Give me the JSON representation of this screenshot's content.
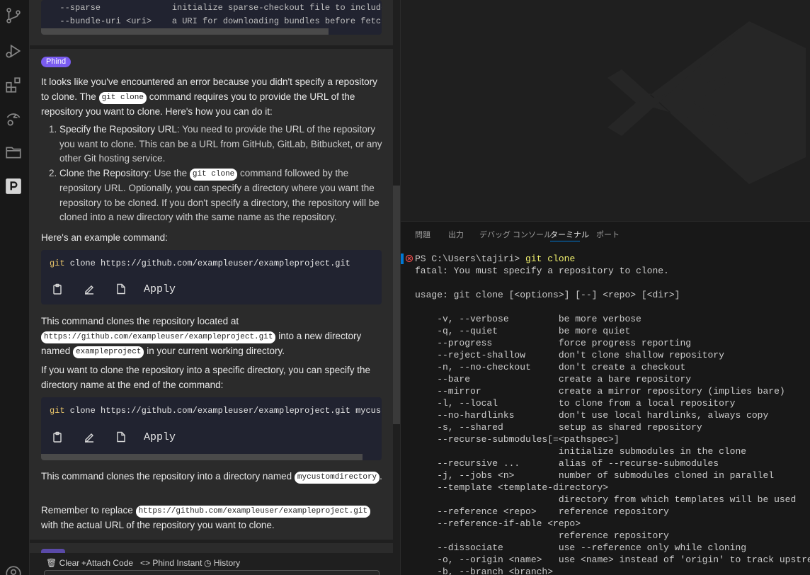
{
  "activity_bar": {
    "icons": [
      "source-control-icon",
      "run-debug-icon",
      "extensions-icon",
      "remote-explorer-icon",
      "folder-icon",
      "phind-icon",
      "account-icon"
    ]
  },
  "chat": {
    "top_help_lines": [
      "  --sparse              initialize sparse-checkout file to include only fil",
      "  --bundle-uri <uri>    a URI for downloading bundles before fetching from"
    ],
    "badge": "Phind",
    "intro": {
      "t1": "It looks like you've encountered an error because you didn't specify a repository to clone. The ",
      "c1": "git clone",
      "t2": " command requires you to provide the URL of the repository you want to clone. Here's how you can do it:"
    },
    "steps": [
      {
        "title": "Specify the Repository URL",
        "body": ": You need to provide the URL of the repository you want to clone. This can be a URL from GitHub, GitLab, Bitbucket, or any other Git hosting service."
      },
      {
        "title": "Clone the Repository",
        "body_pre": ": Use the ",
        "code": "git clone",
        "body_post": " command followed by the repository URL. Optionally, you can specify a directory where you want the repository to be cloned. If you don't specify a directory, the repository will be cloned into a new directory with the same name as the repository."
      }
    ],
    "example_label": "Here's an example command:",
    "code1": {
      "kw": "git",
      "rest": " clone https://github.com/exampleuser/exampleproject.git"
    },
    "code2": {
      "kw": "git",
      "rest": " clone https://github.com/exampleuser/exampleproject.git mycustomdirectory"
    },
    "apply_label": "Apply",
    "para2": {
      "t1": "This command clones the repository located at ",
      "c1": "https://github.com/exampleuser/exampleproject.git",
      "t2": " into a new directory named ",
      "c2": "exampleproject",
      "t3": " in your current working directory."
    },
    "para3": "If you want to clone the repository into a specific directory, you can specify the directory name at the end of the command:",
    "para4": {
      "t1": "This command clones the repository into a directory named ",
      "c1": "mycustomdirectory",
      "t2": "."
    },
    "para5": {
      "t1": "Remember to replace ",
      "c1": "https://github.com/exampleuser/exampleproject.git",
      "t2": " with the actual URL of the repository you want to clone."
    },
    "toolbar": {
      "clear": "Clear",
      "attach": "+Attach Code",
      "instant": "Phind Instant",
      "history": "History"
    }
  },
  "panel": {
    "tabs": [
      "問題",
      "出力",
      "デバッグ コンソール",
      "ターミナル",
      "ポート"
    ],
    "active_tab": "ターミナル",
    "prompt": "PS C:\\Users\\tajiri> ",
    "command": "git clone",
    "output": "fatal: You must specify a repository to clone.\n\nusage: git clone [<options>] [--] <repo> [<dir>]\n\n    -v, --verbose         be more verbose\n    -q, --quiet           be more quiet\n    --progress            force progress reporting\n    --reject-shallow      don't clone shallow repository\n    -n, --no-checkout     don't create a checkout\n    --bare                create a bare repository\n    --mirror              create a mirror repository (implies bare)\n    -l, --local           to clone from a local repository\n    --no-hardlinks        don't use local hardlinks, always copy\n    -s, --shared          setup as shared repository\n    --recurse-submodules[=<pathspec>]\n                          initialize submodules in the clone\n    --recursive ...       alias of --recurse-submodules\n    -j, --jobs <n>        number of submodules cloned in parallel\n    --template <template-directory>\n                          directory from which templates will be used\n    --reference <repo>    reference repository\n    --reference-if-able <repo>\n                          reference repository\n    --dissociate          use --reference only while cloning\n    -o, --origin <name>   use <name> instead of 'origin' to track upstream\n    -b, --branch <branch>"
  },
  "colors": {
    "accent": "#0078d4",
    "phind_badge": "#7a5cf0",
    "terminal_command": "#f2f26e",
    "error_icon": "#f14c4c"
  }
}
